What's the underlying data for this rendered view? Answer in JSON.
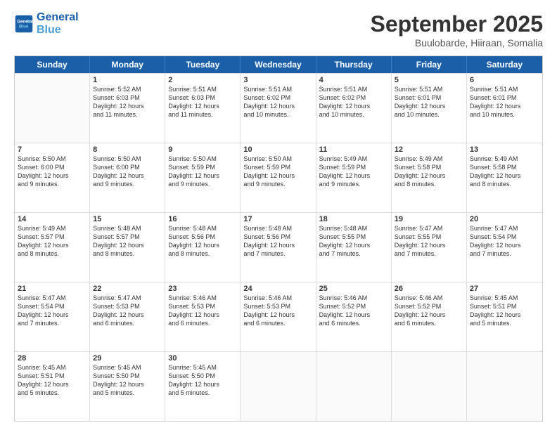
{
  "logo": {
    "line1": "General",
    "line2": "Blue"
  },
  "title": "September 2025",
  "subtitle": "Buulobarde, Hiiraan, Somalia",
  "days": [
    "Sunday",
    "Monday",
    "Tuesday",
    "Wednesday",
    "Thursday",
    "Friday",
    "Saturday"
  ],
  "weeks": [
    [
      {
        "day": "",
        "info": ""
      },
      {
        "day": "1",
        "info": "Sunrise: 5:52 AM\nSunset: 6:03 PM\nDaylight: 12 hours\nand 11 minutes."
      },
      {
        "day": "2",
        "info": "Sunrise: 5:51 AM\nSunset: 6:03 PM\nDaylight: 12 hours\nand 11 minutes."
      },
      {
        "day": "3",
        "info": "Sunrise: 5:51 AM\nSunset: 6:02 PM\nDaylight: 12 hours\nand 10 minutes."
      },
      {
        "day": "4",
        "info": "Sunrise: 5:51 AM\nSunset: 6:02 PM\nDaylight: 12 hours\nand 10 minutes."
      },
      {
        "day": "5",
        "info": "Sunrise: 5:51 AM\nSunset: 6:01 PM\nDaylight: 12 hours\nand 10 minutes."
      },
      {
        "day": "6",
        "info": "Sunrise: 5:51 AM\nSunset: 6:01 PM\nDaylight: 12 hours\nand 10 minutes."
      }
    ],
    [
      {
        "day": "7",
        "info": "Sunrise: 5:50 AM\nSunset: 6:00 PM\nDaylight: 12 hours\nand 9 minutes."
      },
      {
        "day": "8",
        "info": "Sunrise: 5:50 AM\nSunset: 6:00 PM\nDaylight: 12 hours\nand 9 minutes."
      },
      {
        "day": "9",
        "info": "Sunrise: 5:50 AM\nSunset: 5:59 PM\nDaylight: 12 hours\nand 9 minutes."
      },
      {
        "day": "10",
        "info": "Sunrise: 5:50 AM\nSunset: 5:59 PM\nDaylight: 12 hours\nand 9 minutes."
      },
      {
        "day": "11",
        "info": "Sunrise: 5:49 AM\nSunset: 5:59 PM\nDaylight: 12 hours\nand 9 minutes."
      },
      {
        "day": "12",
        "info": "Sunrise: 5:49 AM\nSunset: 5:58 PM\nDaylight: 12 hours\nand 8 minutes."
      },
      {
        "day": "13",
        "info": "Sunrise: 5:49 AM\nSunset: 5:58 PM\nDaylight: 12 hours\nand 8 minutes."
      }
    ],
    [
      {
        "day": "14",
        "info": "Sunrise: 5:49 AM\nSunset: 5:57 PM\nDaylight: 12 hours\nand 8 minutes."
      },
      {
        "day": "15",
        "info": "Sunrise: 5:48 AM\nSunset: 5:57 PM\nDaylight: 12 hours\nand 8 minutes."
      },
      {
        "day": "16",
        "info": "Sunrise: 5:48 AM\nSunset: 5:56 PM\nDaylight: 12 hours\nand 8 minutes."
      },
      {
        "day": "17",
        "info": "Sunrise: 5:48 AM\nSunset: 5:56 PM\nDaylight: 12 hours\nand 7 minutes."
      },
      {
        "day": "18",
        "info": "Sunrise: 5:48 AM\nSunset: 5:55 PM\nDaylight: 12 hours\nand 7 minutes."
      },
      {
        "day": "19",
        "info": "Sunrise: 5:47 AM\nSunset: 5:55 PM\nDaylight: 12 hours\nand 7 minutes."
      },
      {
        "day": "20",
        "info": "Sunrise: 5:47 AM\nSunset: 5:54 PM\nDaylight: 12 hours\nand 7 minutes."
      }
    ],
    [
      {
        "day": "21",
        "info": "Sunrise: 5:47 AM\nSunset: 5:54 PM\nDaylight: 12 hours\nand 7 minutes."
      },
      {
        "day": "22",
        "info": "Sunrise: 5:47 AM\nSunset: 5:53 PM\nDaylight: 12 hours\nand 6 minutes."
      },
      {
        "day": "23",
        "info": "Sunrise: 5:46 AM\nSunset: 5:53 PM\nDaylight: 12 hours\nand 6 minutes."
      },
      {
        "day": "24",
        "info": "Sunrise: 5:46 AM\nSunset: 5:53 PM\nDaylight: 12 hours\nand 6 minutes."
      },
      {
        "day": "25",
        "info": "Sunrise: 5:46 AM\nSunset: 5:52 PM\nDaylight: 12 hours\nand 6 minutes."
      },
      {
        "day": "26",
        "info": "Sunrise: 5:46 AM\nSunset: 5:52 PM\nDaylight: 12 hours\nand 6 minutes."
      },
      {
        "day": "27",
        "info": "Sunrise: 5:45 AM\nSunset: 5:51 PM\nDaylight: 12 hours\nand 5 minutes."
      }
    ],
    [
      {
        "day": "28",
        "info": "Sunrise: 5:45 AM\nSunset: 5:51 PM\nDaylight: 12 hours\nand 5 minutes."
      },
      {
        "day": "29",
        "info": "Sunrise: 5:45 AM\nSunset: 5:50 PM\nDaylight: 12 hours\nand 5 minutes."
      },
      {
        "day": "30",
        "info": "Sunrise: 5:45 AM\nSunset: 5:50 PM\nDaylight: 12 hours\nand 5 minutes."
      },
      {
        "day": "",
        "info": ""
      },
      {
        "day": "",
        "info": ""
      },
      {
        "day": "",
        "info": ""
      },
      {
        "day": "",
        "info": ""
      }
    ]
  ]
}
